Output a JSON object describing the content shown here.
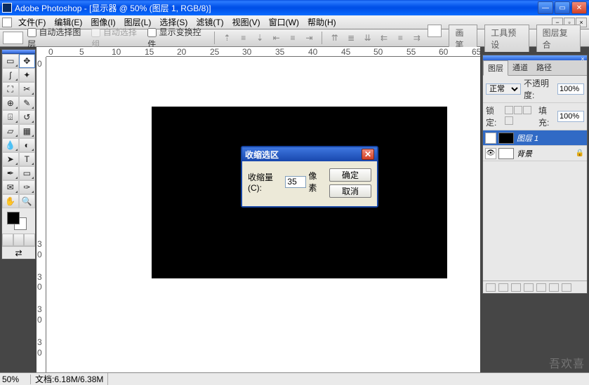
{
  "title": "Adobe Photoshop - [显示器 @ 50% (图层 1, RGB/8)]",
  "menu": [
    "文件(F)",
    "编辑(E)",
    "图像(I)",
    "图层(L)",
    "选择(S)",
    "滤镜(T)",
    "视图(V)",
    "窗口(W)",
    "帮助(H)"
  ],
  "options": {
    "auto_select_layer": "自动选择图层",
    "auto_select_group": "自动选择组",
    "show_transform": "显示变换控件",
    "tabs": [
      "画笔",
      "工具预设",
      "图层复合"
    ]
  },
  "dialog": {
    "title": "收缩选区",
    "amount_label": "收缩量(C):",
    "amount_value": "35",
    "unit": "像素",
    "ok": "确定",
    "cancel": "取消"
  },
  "layers_panel": {
    "tabs": [
      "图层",
      "通道",
      "路径"
    ],
    "blend_mode": "正常",
    "opacity_label": "不透明度:",
    "opacity_value": "100%",
    "lock_label": "锁定:",
    "fill_label": "填充:",
    "fill_value": "100%",
    "layers": [
      {
        "name": "图层 1",
        "thumb": "black",
        "active": true,
        "locked": false
      },
      {
        "name": "背景",
        "thumb": "white",
        "active": false,
        "locked": true
      }
    ]
  },
  "status": {
    "zoom": "50%",
    "file_label": "文档:",
    "file_info": "6.18M/6.38M"
  },
  "ruler_h": [
    "0",
    "5",
    "10",
    "15",
    "20",
    "25",
    "30",
    "35",
    "40",
    "45",
    "50",
    "55",
    "60",
    "65"
  ],
  "ruler_v": [
    "0",
    "3",
    "0",
    "3",
    "0",
    "3",
    "0",
    "3",
    "0"
  ],
  "watermark": "吾欢喜"
}
